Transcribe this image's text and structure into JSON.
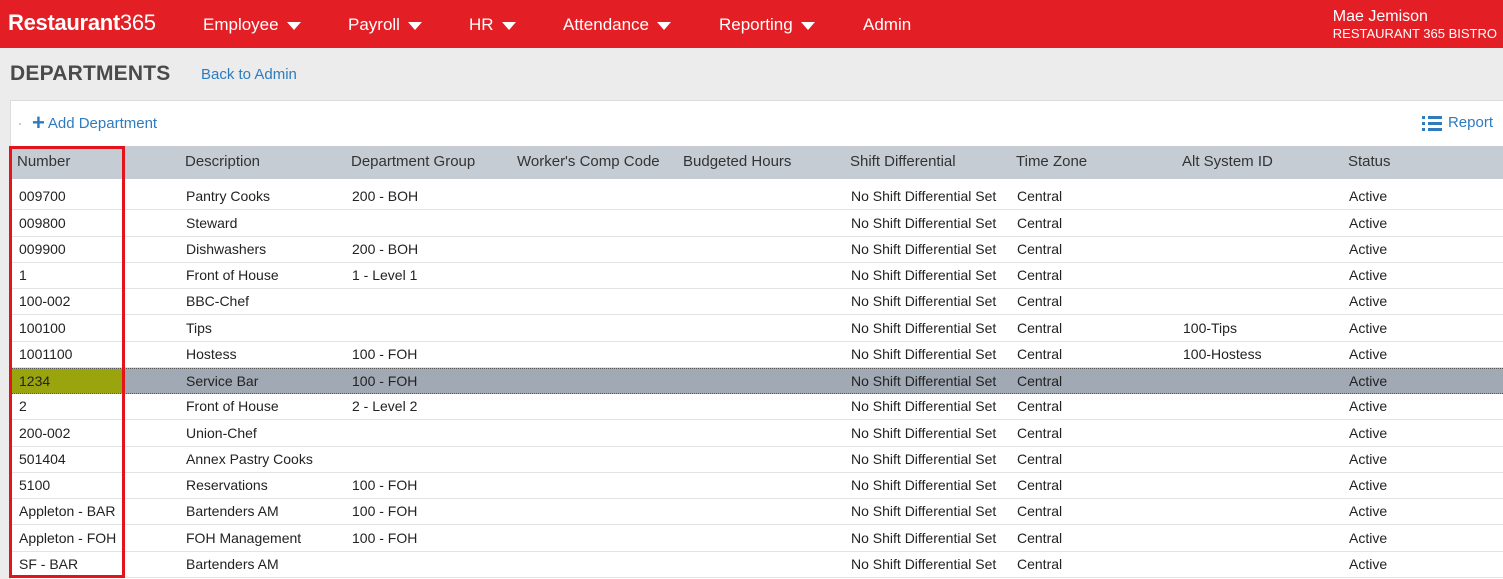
{
  "app": {
    "logo_main": "Restaurant",
    "logo_num": "365"
  },
  "nav": [
    {
      "label": "Employee",
      "dropdown": true
    },
    {
      "label": "Payroll",
      "dropdown": true
    },
    {
      "label": "HR",
      "dropdown": true
    },
    {
      "label": "Attendance",
      "dropdown": true
    },
    {
      "label": "Reporting",
      "dropdown": true
    },
    {
      "label": "Admin",
      "dropdown": false
    }
  ],
  "user": {
    "name": "Mae Jemison",
    "company": "RESTAURANT 365 BISTRO"
  },
  "page": {
    "title": "DEPARTMENTS",
    "back_link": "Back to Admin"
  },
  "toolbar": {
    "add_label": "Add Department",
    "report_label": "Report"
  },
  "table": {
    "columns": [
      "Number",
      "Description",
      "Department Group",
      "Worker's Comp Code",
      "Budgeted Hours",
      "Shift Differential",
      "Time Zone",
      "Alt System ID",
      "Status"
    ],
    "selected_row": 7,
    "rows": [
      [
        "009700",
        "Pantry Cooks",
        "200 - BOH",
        "",
        "",
        "No Shift Differential Set",
        "Central",
        "",
        "Active"
      ],
      [
        "009800",
        "Steward",
        "",
        "",
        "",
        "No Shift Differential Set",
        "Central",
        "",
        "Active"
      ],
      [
        "009900",
        "Dishwashers",
        "200 - BOH",
        "",
        "",
        "No Shift Differential Set",
        "Central",
        "",
        "Active"
      ],
      [
        "1",
        "Front of House",
        "1 - Level 1",
        "",
        "",
        "No Shift Differential Set",
        "Central",
        "",
        "Active"
      ],
      [
        "100-002",
        "BBC-Chef",
        "",
        "",
        "",
        "No Shift Differential Set",
        "Central",
        "",
        "Active"
      ],
      [
        "100100",
        "Tips",
        "",
        "",
        "",
        "No Shift Differential Set",
        "Central",
        "100-Tips",
        "Active"
      ],
      [
        "1001100",
        "Hostess",
        "100 - FOH",
        "",
        "",
        "No Shift Differential Set",
        "Central",
        "100-Hostess",
        "Active"
      ],
      [
        "1234",
        "Service Bar",
        "100 - FOH",
        "",
        "",
        "No Shift Differential Set",
        "Central",
        "",
        "Active"
      ],
      [
        "2",
        "Front of House",
        "2 - Level 2",
        "",
        "",
        "No Shift Differential Set",
        "Central",
        "",
        "Active"
      ],
      [
        "200-002",
        "Union-Chef",
        "",
        "",
        "",
        "No Shift Differential Set",
        "Central",
        "",
        "Active"
      ],
      [
        "501404",
        "Annex Pastry Cooks",
        "",
        "",
        "",
        "No Shift Differential Set",
        "Central",
        "",
        "Active"
      ],
      [
        "5100",
        "Reservations",
        "100 - FOH",
        "",
        "",
        "No Shift Differential Set",
        "Central",
        "",
        "Active"
      ],
      [
        "Appleton - BAR",
        "Bartenders AM",
        "100 - FOH",
        "",
        "",
        "No Shift Differential Set",
        "Central",
        "",
        "Active"
      ],
      [
        "Appleton - FOH",
        "FOH Management",
        "100 - FOH",
        "",
        "",
        "No Shift Differential Set",
        "Central",
        "",
        "Active"
      ],
      [
        "SF - BAR",
        "Bartenders AM",
        "",
        "",
        "",
        "No Shift Differential Set",
        "Central",
        "",
        "Active"
      ]
    ]
  },
  "colors": {
    "brand": "#e31e24",
    "link": "#2e7bbf",
    "header_bg": "#c5ccd4",
    "selected_row": "#a1a9b4",
    "highlight_cell": "#9aa50e",
    "annotation_box": "#e3141c"
  }
}
